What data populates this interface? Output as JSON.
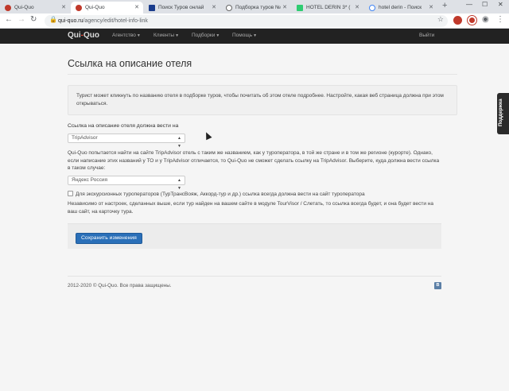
{
  "browser": {
    "tabs": [
      {
        "label": "Qui-Quo",
        "active": false
      },
      {
        "label": "Qui-Quo",
        "active": true
      },
      {
        "label": "Поиск Туров онлай",
        "active": false
      },
      {
        "label": "Подборка туров №",
        "active": false
      },
      {
        "label": "HOTEL DERIN 3* (",
        "active": false
      },
      {
        "label": "hotel derin - Поиск",
        "active": false
      }
    ],
    "url_host": "qui-quo.ru",
    "url_path": "/agency/edit/hotel-info-link"
  },
  "navbar": {
    "logo_left": "Qui",
    "logo_dash": "-",
    "logo_right": "Quo",
    "items": [
      "Агентство",
      "Клиенты",
      "Подборки",
      "Помощь"
    ],
    "logout": "Выйти"
  },
  "page": {
    "title": "Ссылка на описание отеля",
    "intro": "Турист может кликнуть по названию отеля в подборке туров, чтобы почитать об этом отеле подробнее. Настройте, какая веб страница должна при этом открываться.",
    "link_label": "Ссылка на описание отеля должна вести на",
    "link_select_value": "TripAdvisor",
    "explanation": "Qui-Quo попытается найти на сайте TripAdvisor отель с таким же названием, как у туроператора, в той же стране и в том же регионе (курорте). Однако, если написание этих названий у ТО и у TripAdvisor отличается, то Qui-Quo не сможет сделать ссылку на TripAdvisor. Выберите, куда должна вести ссылка в таком случае:",
    "fallback_select_value": "Яндекс Россия",
    "checkbox_label": "Для экскурсионных туроператоров (ТурТрансВояж, Аккорд-тур и др.) ссылка всегда должна вести на сайт туроператора",
    "note": "Независимо от настроек, сделанных выше, если тур найден на вашем сайте в модуле TourVisor / Слетать, то ссылка всегда будет, и она будет вести на ваш сайт, на карточку тура.",
    "save_button": "Сохранить изменения",
    "footer": "2012-2020 © Qui-Quo. Все права защищены.",
    "vk": "В",
    "support": "Поддержка"
  }
}
